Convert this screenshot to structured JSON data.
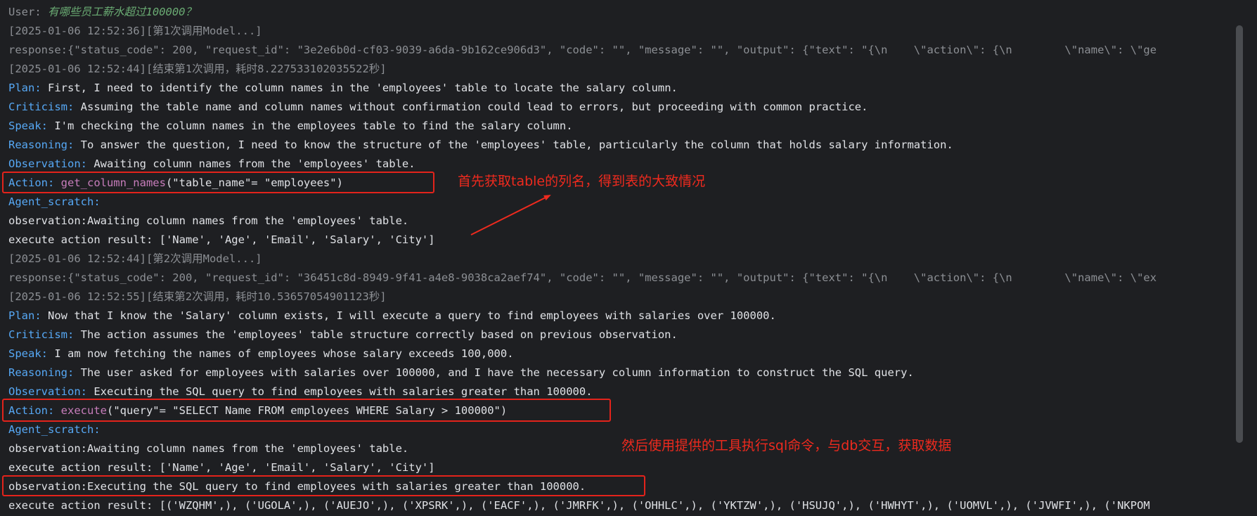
{
  "console": {
    "lines": [
      {
        "segments": [
          {
            "t": "User: ",
            "c": "gray"
          },
          {
            "t": "有哪些员工薪水超过100000？",
            "c": "user-text"
          }
        ]
      },
      {
        "segments": [
          {
            "t": "[2025-01-06 12:52:36][第1次调用Model...]",
            "c": "gray"
          }
        ]
      },
      {
        "segments": [
          {
            "t": "response:{\"status_code\": 200, \"request_id\": \"3e2e6b0d-cf03-9039-a6da-9b162ce906d3\", \"code\": \"\", \"message\": \"\", \"output\": {\"text\": \"{\\n    \\\"action\\\": {\\n        \\\"name\\\": \\\"ge",
            "c": "gray"
          }
        ]
      },
      {
        "segments": [
          {
            "t": "[2025-01-06 12:52:44][结束第1次调用，耗时8.227533102035522秒]",
            "c": "gray"
          }
        ]
      },
      {
        "segments": [
          {
            "t": "Plan: ",
            "c": "key"
          },
          {
            "t": "First, I need to identify the column names in the 'employees' table to locate the salary column.",
            "c": "plain"
          }
        ]
      },
      {
        "segments": [
          {
            "t": "Criticism: ",
            "c": "key"
          },
          {
            "t": "Assuming the table name and column names without confirmation could lead to errors, but proceeding with common practice.",
            "c": "plain"
          }
        ]
      },
      {
        "segments": [
          {
            "t": "Speak: ",
            "c": "key"
          },
          {
            "t": "I'm checking the column names in the employees table to find the salary column.",
            "c": "plain"
          }
        ]
      },
      {
        "segments": [
          {
            "t": "Reasoning: ",
            "c": "key"
          },
          {
            "t": "To answer the question, I need to know the structure of the 'employees' table, particularly the column that holds salary information.",
            "c": "plain"
          }
        ]
      },
      {
        "segments": [
          {
            "t": "Observation: ",
            "c": "key"
          },
          {
            "t": "Awaiting column names from the 'employees' table.",
            "c": "plain"
          }
        ]
      },
      {
        "segments": [
          {
            "t": "Action: ",
            "c": "key"
          },
          {
            "t": "get_column_names",
            "c": "func"
          },
          {
            "t": "(\"table_name\"= \"employees\")",
            "c": "plain"
          }
        ]
      },
      {
        "segments": [
          {
            "t": "Agent_scratch:",
            "c": "key"
          }
        ]
      },
      {
        "segments": [
          {
            "t": "observation:Awaiting column names from the 'employees' table.",
            "c": "plain"
          }
        ]
      },
      {
        "segments": [
          {
            "t": "execute action result: ['Name', 'Age', 'Email', 'Salary', 'City']",
            "c": "plain"
          }
        ]
      },
      {
        "segments": [
          {
            "t": "[2025-01-06 12:52:44][第2次调用Model...]",
            "c": "gray"
          }
        ]
      },
      {
        "segments": [
          {
            "t": "response:{\"status_code\": 200, \"request_id\": \"36451c8d-8949-9f41-a4e8-9038ca2aef74\", \"code\": \"\", \"message\": \"\", \"output\": {\"text\": \"{\\n    \\\"action\\\": {\\n        \\\"name\\\": \\\"ex",
            "c": "gray"
          }
        ]
      },
      {
        "segments": [
          {
            "t": "[2025-01-06 12:52:55][结束第2次调用，耗时10.53657054901123秒]",
            "c": "gray"
          }
        ]
      },
      {
        "segments": [
          {
            "t": "Plan: ",
            "c": "key"
          },
          {
            "t": "Now that I know the 'Salary' column exists, I will execute a query to find employees with salaries over 100000.",
            "c": "plain"
          }
        ]
      },
      {
        "segments": [
          {
            "t": "Criticism: ",
            "c": "key"
          },
          {
            "t": "The action assumes the 'employees' table structure correctly based on previous observation.",
            "c": "plain"
          }
        ]
      },
      {
        "segments": [
          {
            "t": "Speak: ",
            "c": "key"
          },
          {
            "t": "I am now fetching the names of employees whose salary exceeds 100,000.",
            "c": "plain"
          }
        ]
      },
      {
        "segments": [
          {
            "t": "Reasoning: ",
            "c": "key"
          },
          {
            "t": "The user asked for employees with salaries over 100000, and I have the necessary column information to construct the SQL query.",
            "c": "plain"
          }
        ]
      },
      {
        "segments": [
          {
            "t": "Observation: ",
            "c": "key"
          },
          {
            "t": "Executing the SQL query to find employees with salaries greater than 100000.",
            "c": "plain"
          }
        ]
      },
      {
        "segments": [
          {
            "t": "Action: ",
            "c": "key"
          },
          {
            "t": "execute",
            "c": "func"
          },
          {
            "t": "(\"query\"= \"SELECT Name FROM employees WHERE Salary > 100000\")",
            "c": "plain"
          }
        ]
      },
      {
        "segments": [
          {
            "t": "Agent_scratch:",
            "c": "key"
          }
        ]
      },
      {
        "segments": [
          {
            "t": "observation:Awaiting column names from the 'employees' table.",
            "c": "plain"
          }
        ]
      },
      {
        "segments": [
          {
            "t": "execute action result: ['Name', 'Age', 'Email', 'Salary', 'City']",
            "c": "plain"
          }
        ]
      },
      {
        "segments": [
          {
            "t": "observation:Executing the SQL query to find employees with salaries greater than 100000.",
            "c": "plain"
          }
        ]
      },
      {
        "segments": [
          {
            "t": "execute action result: [('WZQHM',), ('UGOLA',), ('AUEJO',), ('XPSRK',), ('EACF',), ('JMRFK',), ('OHHLC',), ('YKTZW',), ('HSUJQ',), ('HWHYT',), ('UOMVL',), ('JVWFI',), ('NKPOM",
            "c": "plain"
          }
        ]
      }
    ]
  },
  "annotations": {
    "note_1": "首先获取table的列名，得到表的大致情况",
    "note_2": "然后使用提供的工具执行sql命令，与db交互，获取数据",
    "highlight_color": "#e3231b"
  }
}
